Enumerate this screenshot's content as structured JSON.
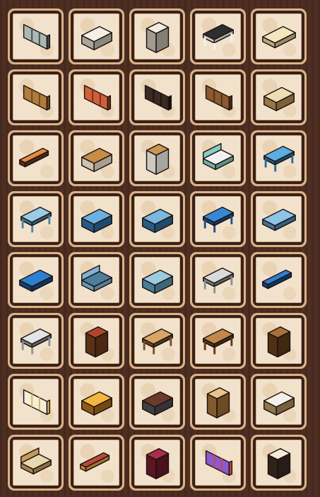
{
  "inventory": {
    "items": [
      {
        "name": "glass-window",
        "shape": "panel",
        "color": "#a9b8b2",
        "accent": "#4a4a4a"
      },
      {
        "name": "white-bathtub",
        "shape": "box",
        "color": "#f4f0e6",
        "accent": "#c9c2b4"
      },
      {
        "name": "white-bookshelf",
        "shape": "tall",
        "color": "#f1ede4",
        "accent": "#bdb6a8"
      },
      {
        "name": "black-table",
        "shape": "table",
        "color": "#2e2e2e",
        "accent": "#f2f2f2"
      },
      {
        "name": "cream-mattress",
        "shape": "slab",
        "color": "#f4e6be",
        "accent": "#d8c597"
      },
      {
        "name": "wooden-fence",
        "shape": "panel",
        "color": "#b07d3a",
        "accent": "#6b4a20"
      },
      {
        "name": "red-fence",
        "shape": "panel",
        "color": "#d0603a",
        "accent": "#7a2f18"
      },
      {
        "name": "black-comb-fence",
        "shape": "panel",
        "color": "#3a2a22",
        "accent": "#1a1210"
      },
      {
        "name": "brown-panel",
        "shape": "panel",
        "color": "#8a5a30",
        "accent": "#4e3018"
      },
      {
        "name": "cream-cabinet",
        "shape": "box",
        "color": "#f0dcb4",
        "accent": "#b58a55"
      },
      {
        "name": "orange-bench",
        "shape": "bench",
        "color": "#e88a40",
        "accent": "#6a3a1e"
      },
      {
        "name": "wooden-chest",
        "shape": "box",
        "color": "#c88c48",
        "accent": "#f0e6d0"
      },
      {
        "name": "dresser",
        "shape": "tall",
        "color": "#c99752",
        "accent": "#f0ece4"
      },
      {
        "name": "teal-bed",
        "shape": "bed",
        "color": "#86cfc0",
        "accent": "#f2f2f2"
      },
      {
        "name": "blue-table",
        "shape": "table",
        "color": "#5aaee0",
        "accent": "#2c6a9a"
      },
      {
        "name": "light-blue-table",
        "shape": "table",
        "color": "#9ccbe6",
        "accent": "#4d87a8"
      },
      {
        "name": "blue-tile-counter",
        "shape": "box",
        "color": "#6ab0e0",
        "accent": "#2d6b9e"
      },
      {
        "name": "blue-bathtub",
        "shape": "box",
        "color": "#7ab8e0",
        "accent": "#2f6d9b"
      },
      {
        "name": "blue-tile-table",
        "shape": "table",
        "color": "#3a86d6",
        "accent": "#1d4f8a"
      },
      {
        "name": "light-blue-slab",
        "shape": "slab",
        "color": "#8ec4e6",
        "accent": "#4a88b0"
      },
      {
        "name": "blue-oval-table",
        "shape": "slab",
        "color": "#2e7fd0",
        "accent": "#184c88"
      },
      {
        "name": "blue-bed-frame",
        "shape": "bed",
        "color": "#7eb4d4",
        "accent": "#4c7f9e"
      },
      {
        "name": "blue-oval-tub",
        "shape": "box",
        "color": "#9ccbe0",
        "accent": "#5a92b0"
      },
      {
        "name": "gray-counter",
        "shape": "table",
        "color": "#d8dadc",
        "accent": "#8c9094"
      },
      {
        "name": "blue-bench",
        "shape": "bench",
        "color": "#2e7fd0",
        "accent": "#184c88"
      },
      {
        "name": "gray-table",
        "shape": "table",
        "color": "#e2e4e6",
        "accent": "#8e9296"
      },
      {
        "name": "brick-nightstand",
        "shape": "tall",
        "color": "#b0452a",
        "accent": "#6a3a1a"
      },
      {
        "name": "wooden-low-table",
        "shape": "table",
        "color": "#d6a666",
        "accent": "#7a5224"
      },
      {
        "name": "wooden-desk",
        "shape": "table",
        "color": "#c0884a",
        "accent": "#5e3a18"
      },
      {
        "name": "wooden-bookcase",
        "shape": "tall",
        "color": "#a8703a",
        "accent": "#5e3a18"
      },
      {
        "name": "white-shelf",
        "shape": "panel",
        "color": "#f4eedc",
        "accent": "#e0b24a"
      },
      {
        "name": "gold-chest",
        "shape": "box",
        "color": "#f2b640",
        "accent": "#a86a1a"
      },
      {
        "name": "stove",
        "shape": "box",
        "color": "#6a3a2a",
        "accent": "#4a4a52"
      },
      {
        "name": "wooden-shelf",
        "shape": "tall",
        "color": "#e8c48a",
        "accent": "#9a6a34"
      },
      {
        "name": "kitchen-counter",
        "shape": "box",
        "color": "#f4f0e8",
        "accent": "#a88a58"
      },
      {
        "name": "wooden-bed",
        "shape": "bed",
        "color": "#c89a5a",
        "accent": "#e8d8b0"
      },
      {
        "name": "red-long-box",
        "shape": "bench",
        "color": "#b84a3a",
        "accent": "#e8a040"
      },
      {
        "name": "red-throne",
        "shape": "tall",
        "color": "#a8304a",
        "accent": "#6a1a2a"
      },
      {
        "name": "purple-sign",
        "shape": "panel",
        "color": "#8a5ad0",
        "accent": "#c84a3a"
      },
      {
        "name": "white-fireplace",
        "shape": "tall",
        "color": "#f4ecd8",
        "accent": "#3a2a22"
      }
    ]
  }
}
